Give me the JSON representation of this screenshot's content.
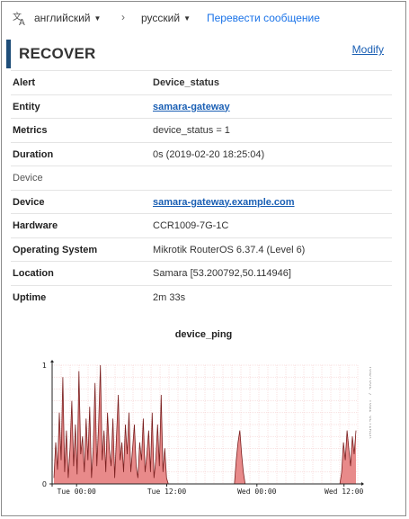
{
  "translate_bar": {
    "icon": "translate-icon",
    "source_language": "английский",
    "target_language": "русский",
    "arrow": "›",
    "translate_link": "Перевести сообщение"
  },
  "header": {
    "status": "RECOVER",
    "modify_label": "Modify",
    "accent_color": "#1f4e79"
  },
  "details": [
    {
      "key": "Alert",
      "value": "Device_status",
      "style": "bold"
    },
    {
      "key": "Entity",
      "value": "samara-gateway",
      "style": "link"
    },
    {
      "key": "Metrics",
      "value": "device_status = 1",
      "style": "plain"
    },
    {
      "key": "Duration",
      "value": "0s (2019-02-20 18:25:04)",
      "style": "plain"
    },
    {
      "key": "Device",
      "value": "",
      "style": "section"
    },
    {
      "key": "Device",
      "value": "samara-gateway.example.com",
      "style": "link"
    },
    {
      "key": "Hardware",
      "value": "CCR1009-7G-1C",
      "style": "plain"
    },
    {
      "key": "Operating System",
      "value": "Mikrotik RouterOS 6.37.4 (Level 6)",
      "style": "plain"
    },
    {
      "key": "Location",
      "value": "Samara [53.200792,50.114946]",
      "style": "plain"
    },
    {
      "key": "Uptime",
      "value": "2m 33s",
      "style": "plain"
    }
  ],
  "chart_title": "device_ping",
  "chart_data": {
    "type": "area",
    "title": "device_ping",
    "ylim": [
      0,
      1
    ],
    "y_ticks": [
      "0",
      "1"
    ],
    "x_tick_labels": [
      "Tue 00:00",
      "Tue 12:00",
      "Wed 00:00",
      "Wed 12:00"
    ],
    "watermark": "RRDTOOL / TOBI OETIKER",
    "grid": true,
    "fill_color": "#e88a8a",
    "line_color": "#7a1f1f",
    "series": [
      {
        "values": [
          0.05,
          0.35,
          0.12,
          0.6,
          0.2,
          0.9,
          0.1,
          0.45,
          0.05,
          0.3,
          0.7,
          0.15,
          0.5,
          0.08,
          0.95,
          0.25,
          0.4,
          0.1,
          0.55,
          0.2,
          0.65,
          0.05,
          0.3,
          0.85,
          0.15,
          0.5,
          1.0,
          0.2,
          0.45,
          0.1,
          0.6,
          0.3,
          0.15,
          0.55,
          0.05,
          0.4,
          0.75,
          0.2,
          0.35,
          0.1,
          0.5,
          0.25,
          0.6,
          0.1,
          0.3,
          0.5,
          0.15,
          0.05,
          0.35,
          0.2,
          0.55,
          0.1,
          0.25,
          0.45,
          0.1,
          0.6,
          0.05,
          0.2,
          0.5,
          0.15,
          0.75,
          0.1,
          0.3,
          0.05,
          0,
          0,
          0,
          0,
          0,
          0,
          0,
          0,
          0,
          0,
          0,
          0,
          0,
          0,
          0,
          0,
          0,
          0,
          0,
          0,
          0,
          0,
          0,
          0,
          0,
          0,
          0,
          0,
          0,
          0,
          0,
          0,
          0,
          0,
          0,
          0,
          0,
          0,
          0.2,
          0.35,
          0.45,
          0.25,
          0.1,
          0,
          0,
          0,
          0,
          0,
          0,
          0,
          0,
          0,
          0,
          0,
          0,
          0,
          0,
          0,
          0,
          0,
          0,
          0,
          0,
          0,
          0,
          0,
          0,
          0,
          0,
          0,
          0,
          0,
          0,
          0,
          0,
          0,
          0,
          0,
          0,
          0,
          0,
          0,
          0,
          0,
          0,
          0,
          0,
          0,
          0,
          0,
          0,
          0,
          0,
          0,
          0,
          0,
          0,
          0.1,
          0.35,
          0.2,
          0.45,
          0.3,
          0.15,
          0.4,
          0.25,
          0.45
        ]
      }
    ]
  }
}
